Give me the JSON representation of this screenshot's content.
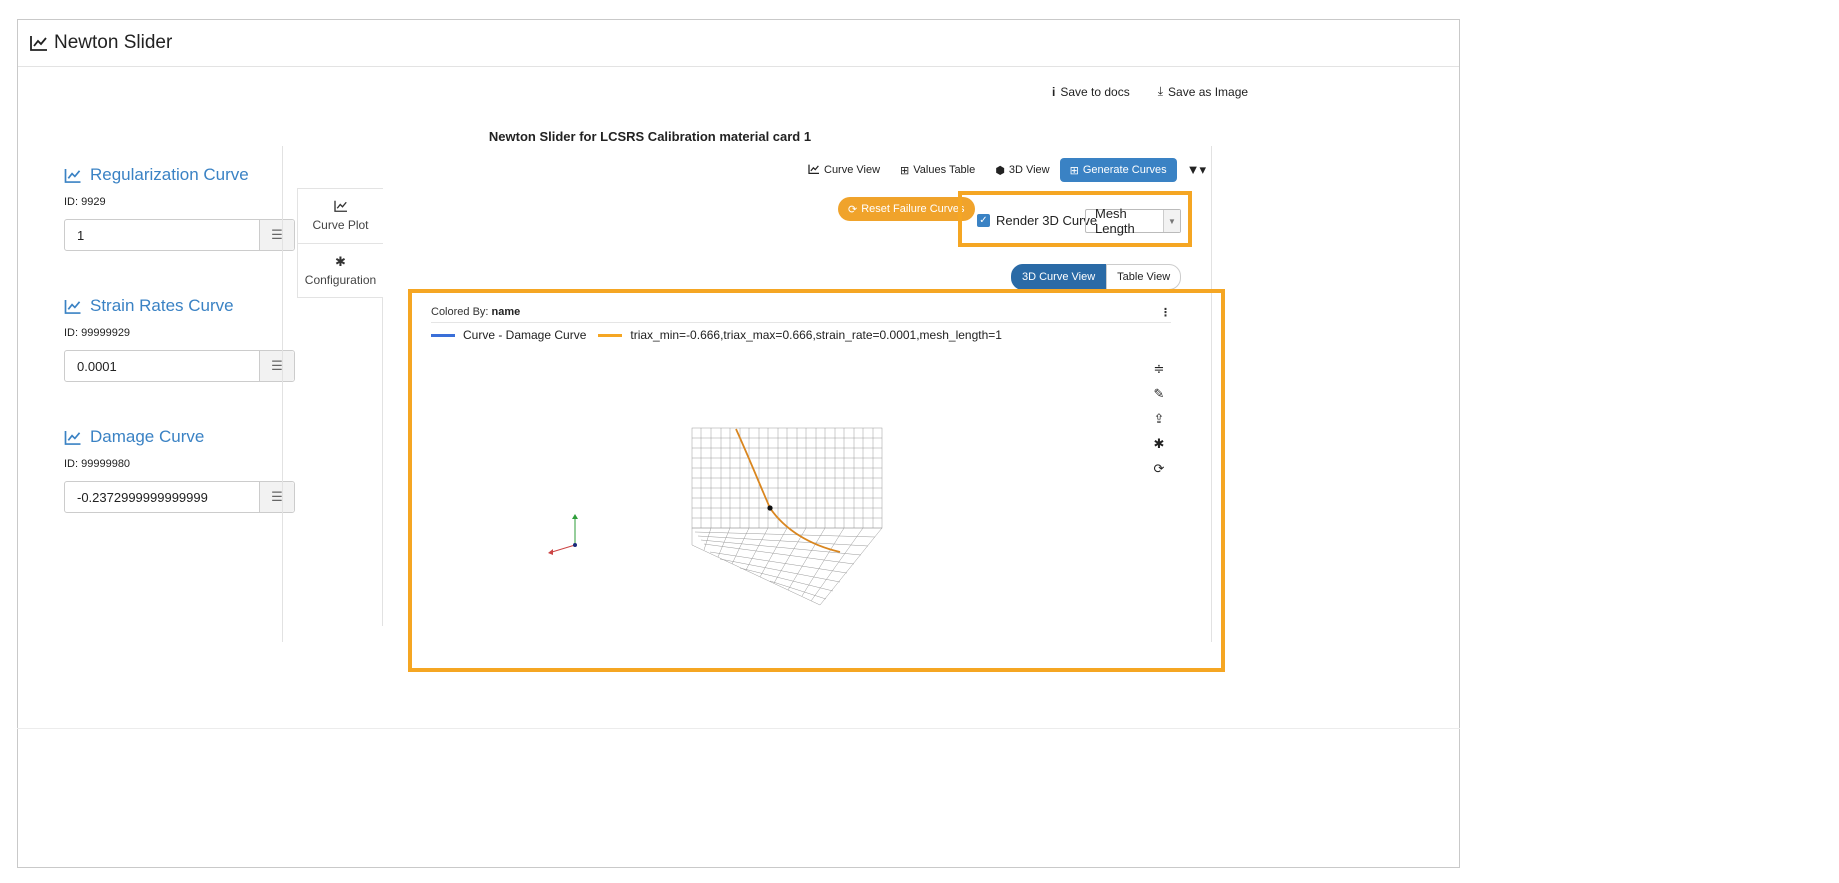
{
  "app": {
    "title": "Newton Slider",
    "icon": "line-chart-icon"
  },
  "actions": {
    "save_docs": "Save to docs",
    "save_image": "Save as Image"
  },
  "main_title": "Newton Slider for LCSRS Calibration material card 1",
  "curves": [
    {
      "heading": "Regularization Curve",
      "id": "ID: 9929",
      "value": "1"
    },
    {
      "heading": "Strain Rates Curve",
      "id": "ID: 99999929",
      "value": "0.0001"
    },
    {
      "heading": "Damage Curve",
      "id": "ID: 99999980",
      "value": "-0.2372999999999999"
    }
  ],
  "vtabs": [
    {
      "label": "Curve Plot",
      "icon": "line-chart-icon"
    },
    {
      "label": "Configuration",
      "icon": "gear-icon"
    }
  ],
  "view_tabs": [
    {
      "label": "Curve View",
      "icon": "line-chart-icon"
    },
    {
      "label": "Values Table",
      "icon": "table-icon"
    },
    {
      "label": "3D View",
      "icon": "cube-icon"
    },
    {
      "label": "Generate Curves",
      "icon": "table-icon",
      "active": true
    }
  ],
  "reset_label": "Reset Failure Curves",
  "render_label": "Render 3D Curve",
  "render_checked": true,
  "mesh_select": "Mesh Length",
  "segments": {
    "active": "3D Curve View",
    "other": "Table View"
  },
  "plot": {
    "colored_by_prefix": "Colored By:",
    "colored_by_value": "name",
    "legend": [
      {
        "label": "Curve - Damage Curve",
        "color": "#3a6fd8"
      },
      {
        "label": "triax_min=-0.666,triax_max=0.666,strain_rate=0.0001,mesh_length=1",
        "color": "#f5a623"
      }
    ]
  },
  "colors": {
    "accent": "#3a82c4",
    "highlight": "#f5a623",
    "reset": "#f0a32b"
  }
}
